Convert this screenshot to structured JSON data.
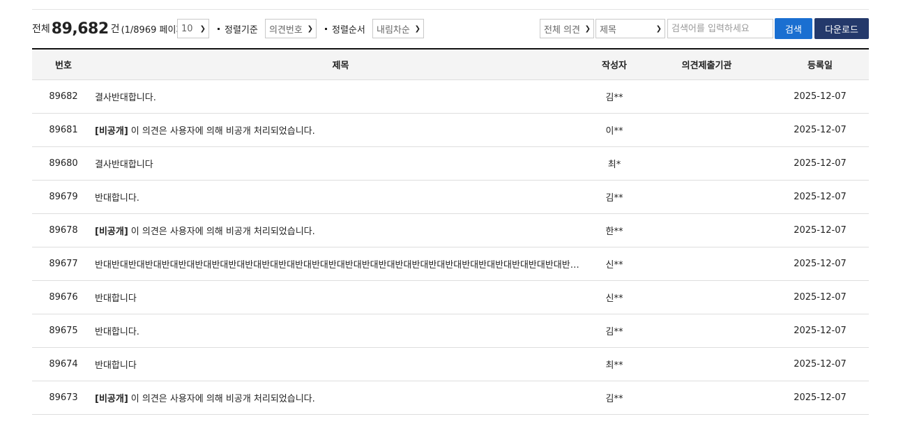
{
  "summary": {
    "total_label": "전체",
    "total_count": "89,682",
    "count_unit": "건",
    "page_info": "(1/8969 페이지)"
  },
  "per_page": {
    "value": "10"
  },
  "sort_by": {
    "label": "정렬기준",
    "value": "의견번호"
  },
  "sort_order": {
    "label": "정렬순서",
    "value": "내림차순"
  },
  "filter_category": {
    "value": "전체 의견"
  },
  "search_field": {
    "value": "제목"
  },
  "search": {
    "placeholder": "검색어를 입력하세요",
    "button_label": "검색"
  },
  "download_label": "다운로드",
  "table": {
    "headers": {
      "no": "번호",
      "title": "제목",
      "author": "작성자",
      "org": "의견제출기관",
      "date": "등록일"
    },
    "rows": [
      {
        "no": "89682",
        "tag": "",
        "title": "결사반대합니다.",
        "author": "김**",
        "org": "",
        "date": "2025-12-07"
      },
      {
        "no": "89681",
        "tag": "[비공개]",
        "title": "이 의견은 사용자에 의해 비공개 처리되었습니다.",
        "author": "이**",
        "org": "",
        "date": "2025-12-07"
      },
      {
        "no": "89680",
        "tag": "",
        "title": "결사반대합니다",
        "author": "최*",
        "org": "",
        "date": "2025-12-07"
      },
      {
        "no": "89679",
        "tag": "",
        "title": "반대합니다.",
        "author": "김**",
        "org": "",
        "date": "2025-12-07"
      },
      {
        "no": "89678",
        "tag": "[비공개]",
        "title": "이 의견은 사용자에 의해 비공개 처리되었습니다.",
        "author": "한**",
        "org": "",
        "date": "2025-12-07"
      },
      {
        "no": "89677",
        "tag": "",
        "title": "반대반대반대반대반대반대반대반대반대반대반대반대반대반대반대반대반대반대반대반대반대반대반대반대반대반대반대반대반대반대반...",
        "author": "신**",
        "org": "",
        "date": "2025-12-07"
      },
      {
        "no": "89676",
        "tag": "",
        "title": "반대합니다",
        "author": "신**",
        "org": "",
        "date": "2025-12-07"
      },
      {
        "no": "89675",
        "tag": "",
        "title": "반대합니다.",
        "author": "김**",
        "org": "",
        "date": "2025-12-07"
      },
      {
        "no": "89674",
        "tag": "",
        "title": "반대합니다",
        "author": "최**",
        "org": "",
        "date": "2025-12-07"
      },
      {
        "no": "89673",
        "tag": "[비공개]",
        "title": "이 의견은 사용자에 의해 비공개 처리되었습니다.",
        "author": "김**",
        "org": "",
        "date": "2025-12-07"
      }
    ]
  },
  "colors": {
    "search_button": "#1a6fd1",
    "download_button": "#24396b",
    "header_bg": "#f4f4f4",
    "header_top_border": "#111111"
  },
  "icons": {
    "select_arrow": "chevron-down-icon",
    "label_bullet": "bullet-icon"
  }
}
